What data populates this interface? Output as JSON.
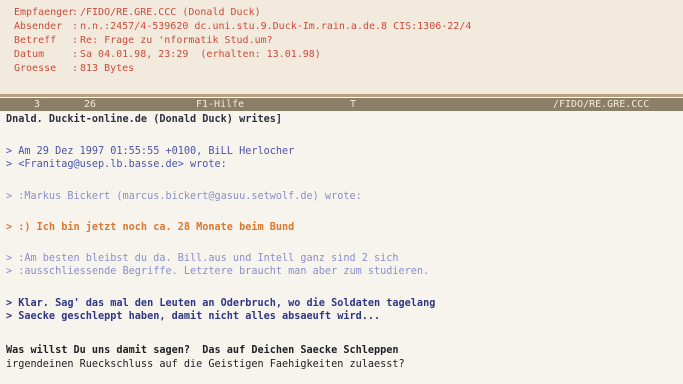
{
  "header": {
    "from": {
      "label": "Empfaenger",
      "value": "/FIDO/RE.GRE.CCC (Donald Duck)"
    },
    "sender": {
      "label": "Absender",
      "value": "n.n.:2457/4-539620 dc.uni.stu.9.Duck-Im.rain.a.de.8 CIS:1306-22/4"
    },
    "subject": {
      "label": "Betreff",
      "value": "Re: Frage zu 'nformatik Stud.um?"
    },
    "date": {
      "label": "Datum",
      "value": "Sa 04.01.98, 23:29  (erhalten: 13.01.98)"
    },
    "size": {
      "label": "Groesse",
      "value": "813 Bytes"
    }
  },
  "statusbar": {
    "seg1": "3",
    "seg2": "26",
    "seg3": "F1-Hilfe",
    "seg4": "T",
    "seg5": "/FIDO/RE.GRE.CCC"
  },
  "message": {
    "lines": [
      "Dnald. Duckit-online.de (Donald Duck) writes]",
      "> Am 29 Dez 1997 01:55:55 +0100, BiLL Herlocher",
      "> <Franitag@usep.lb.basse.de> wrote:",
      "> :Markus Bickert (marcus.bickert@gasuu.setwolf.de) wrote:",
      "> :) Ich bin jetzt noch ca. 28 Monate beim Bund",
      "> :Am besten bleibst du da. Bill.aus und Intell ganz sind 2 sich",
      "> :ausschliessende Begriffe. Letztere braucht man aber zum studieren.",
      "> Klar. Sag' das mal den Leuten an Oderbruch, wo die Soldaten tagelang",
      "> Saecke geschleppt haben, damit nicht alles absaeuft wird...",
      "Was willst Du uns damit sagen?  Das auf Deichen Saecke Schleppen",
      "irgendeinen Rueckschluss auf die Geistigen Faehigkeiten zulaesst?"
    ]
  },
  "colors": {
    "header_bg": "#f2eadc",
    "header_text": "#cc4b3c",
    "status_bg": "#8c7f68",
    "status_text": "#f4ead7",
    "body_bg": "#f7f4ee",
    "quote_blue": "#4c54a8",
    "quote_lavender": "#8a8fc9",
    "quote_orange": "#d9782e",
    "quote_navy": "#2f3684"
  }
}
